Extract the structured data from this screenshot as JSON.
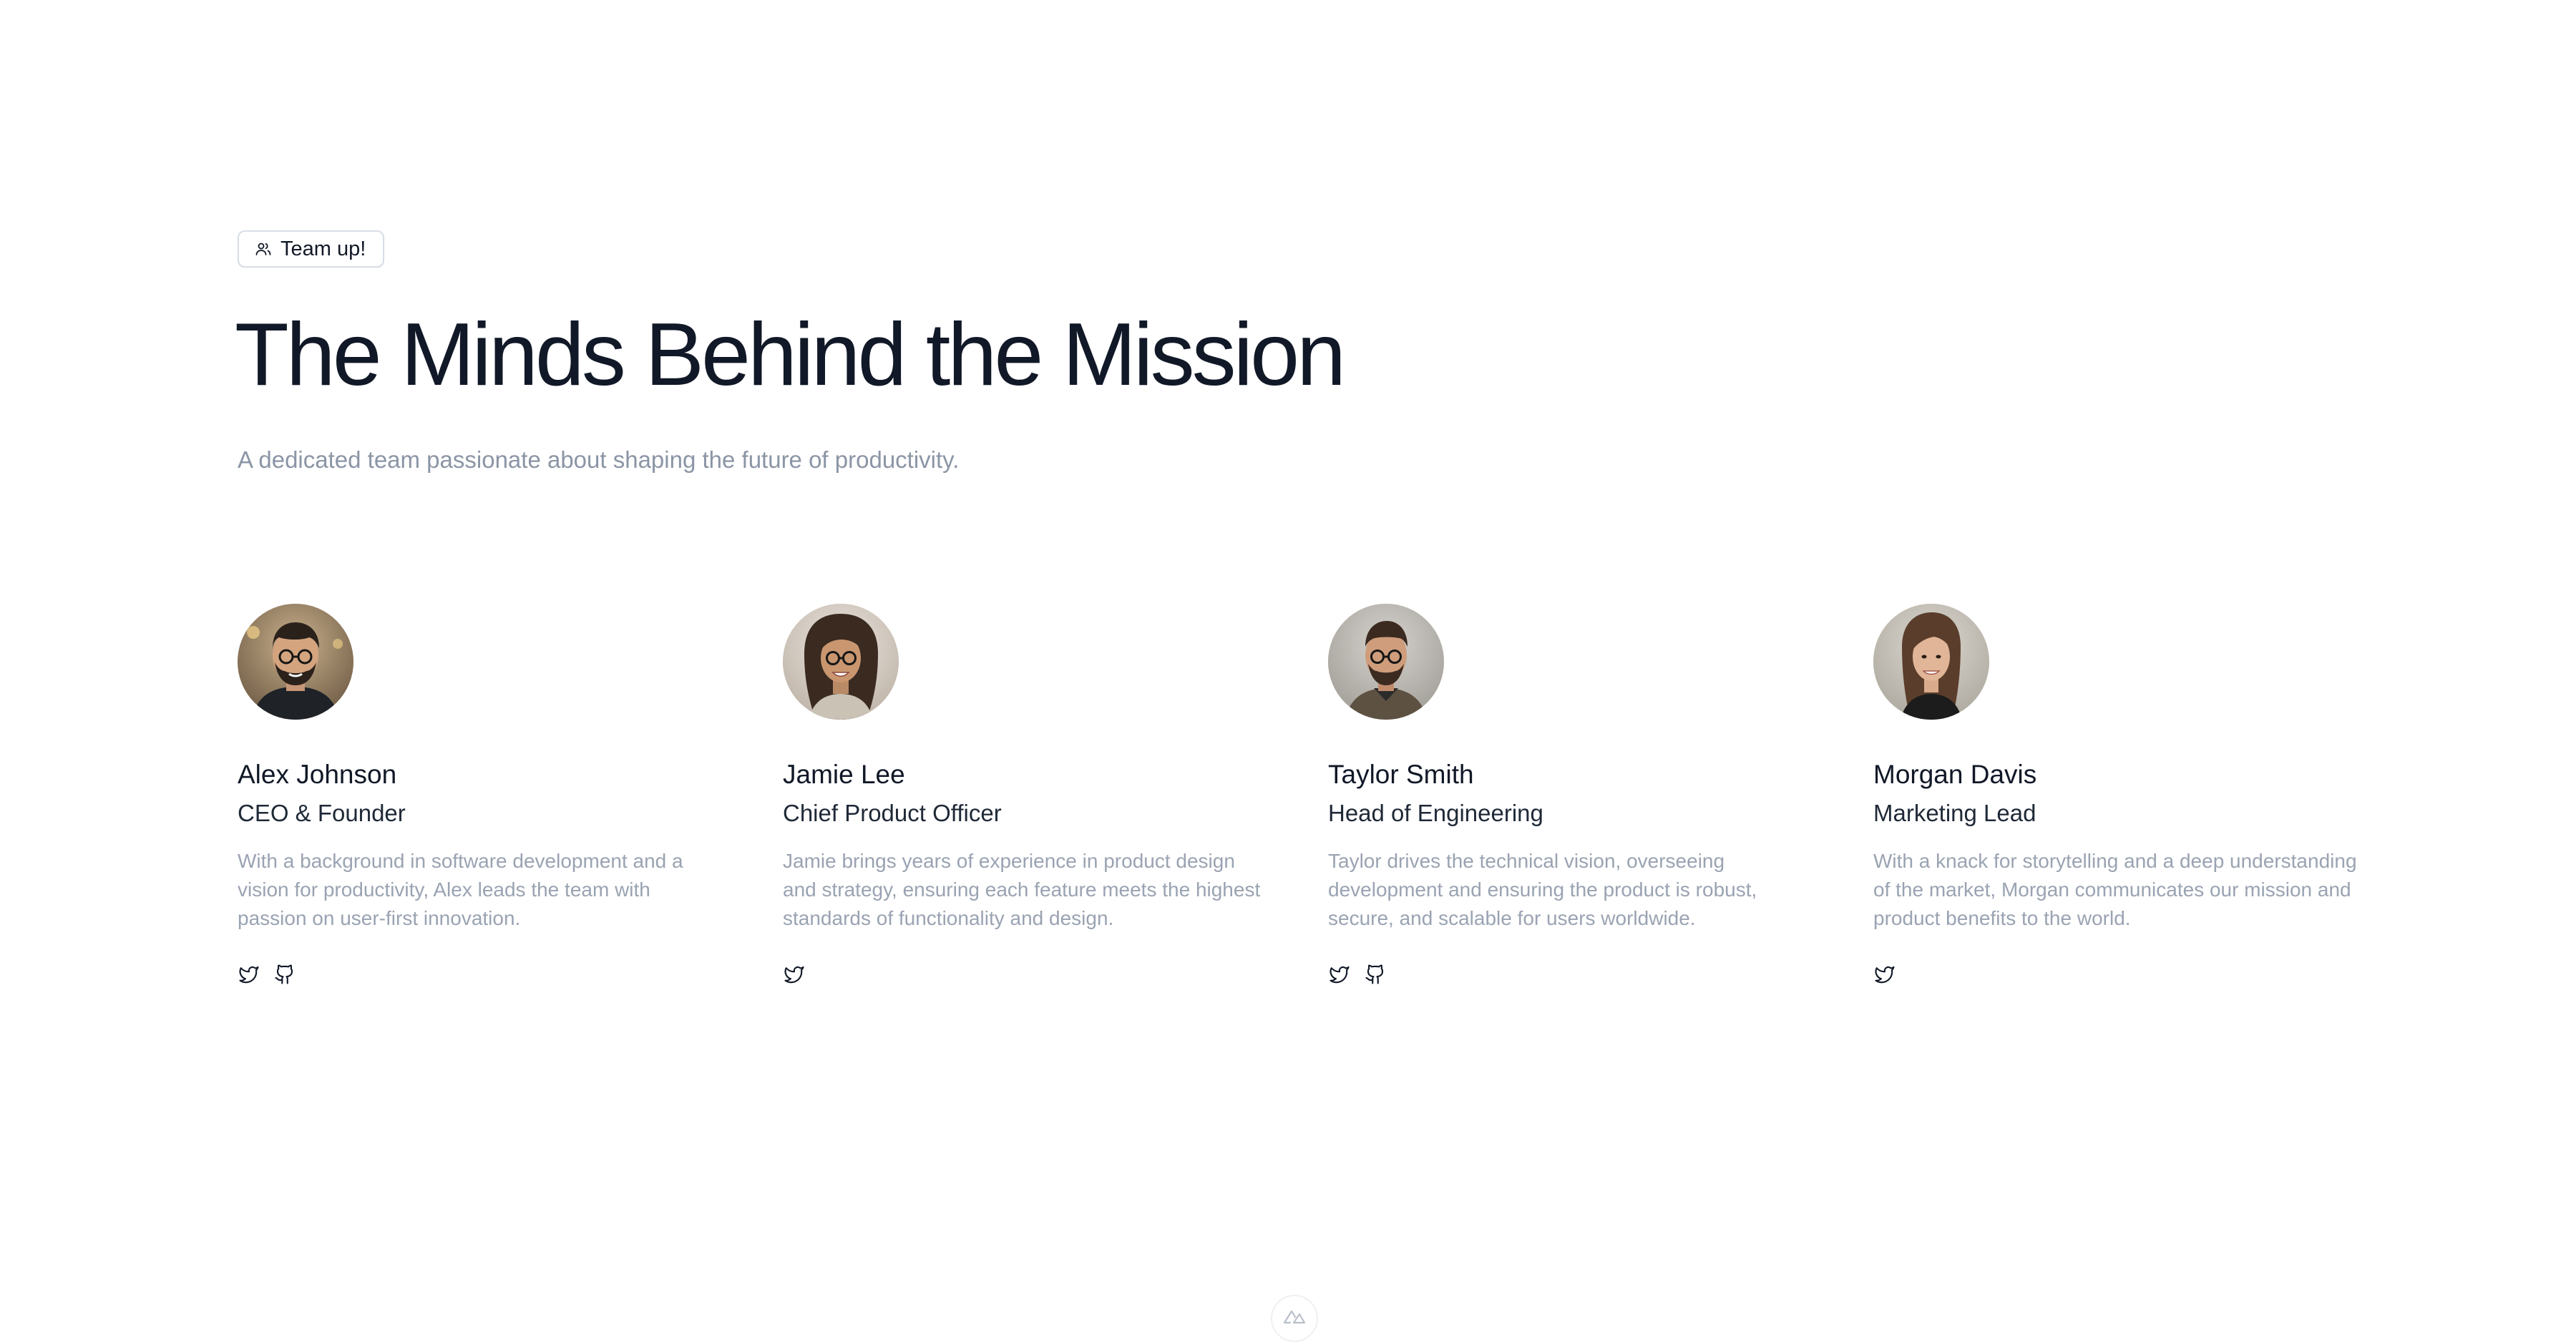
{
  "header": {
    "badge": {
      "label": "Team up!",
      "icon": "users-icon"
    },
    "title": "The Minds Behind the Mission",
    "subtitle": "A dedicated team passionate about shaping the future of productivity."
  },
  "team": [
    {
      "name": "Alex Johnson",
      "role": "CEO & Founder",
      "bio": "With a background in software development and a vision for productivity, Alex leads the team with passion on user-first innovation.",
      "socials": [
        "twitter-icon",
        "github-icon"
      ]
    },
    {
      "name": "Jamie Lee",
      "role": "Chief Product Officer",
      "bio": "Jamie brings years of experience in product design and strategy, ensuring each feature meets the highest standards of functionality and design.",
      "socials": [
        "twitter-icon"
      ]
    },
    {
      "name": "Taylor Smith",
      "role": "Head of Engineering",
      "bio": "Taylor drives the technical vision, overseeing development and ensuring the product is robust, secure, and scalable for users worldwide.",
      "socials": [
        "twitter-icon",
        "github-icon"
      ]
    },
    {
      "name": "Morgan Davis",
      "role": "Marketing Lead",
      "bio": "With a knack for storytelling and a deep understanding of the market, Morgan communicates our mission and product benefits to the world.",
      "socials": [
        "twitter-icon"
      ]
    }
  ],
  "footer": {
    "logo_icon": "nuxt-logo-icon"
  },
  "colors": {
    "heading": "#111827",
    "muted": "#9aa3b2",
    "border": "#d8dde5"
  }
}
